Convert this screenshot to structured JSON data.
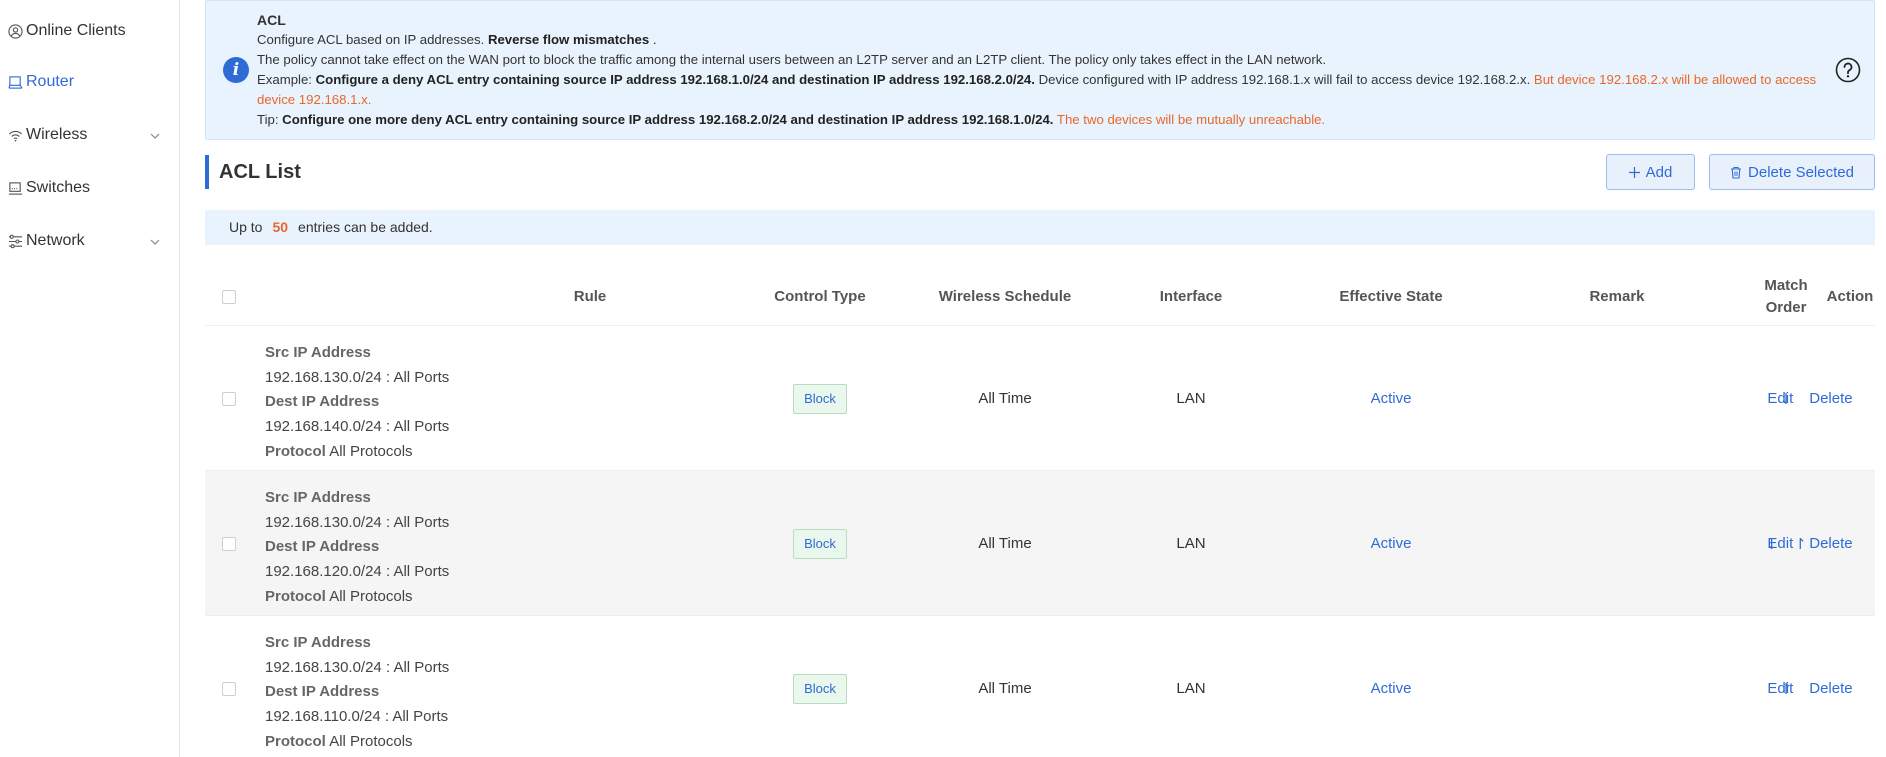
{
  "sidebar": {
    "items": [
      {
        "label": "Online Clients",
        "icon": "user-circle-icon",
        "active": false,
        "expandable": false
      },
      {
        "label": "Router",
        "icon": "router-icon",
        "active": true,
        "expandable": false
      },
      {
        "label": "Wireless",
        "icon": "wifi-icon",
        "active": false,
        "expandable": true
      },
      {
        "label": "Switches",
        "icon": "switch-icon",
        "active": false,
        "expandable": false
      },
      {
        "label": "Network",
        "icon": "network-sliders-icon",
        "active": false,
        "expandable": true
      }
    ]
  },
  "info": {
    "title": "ACL",
    "line1_pre": "Configure ACL based on IP addresses.",
    "line1_bold": "Reverse flow mismatches",
    "line1_post": ".",
    "line2": "The policy cannot take effect on the WAN port to block the traffic among the internal users between an L2TP server and an L2TP client. The policy only takes effect in the LAN network.",
    "example_label": "Example:",
    "example_bold": "Configure a deny ACL entry containing source IP address 192.168.1.0/24 and destination IP address 192.168.2.0/24.",
    "example_text": "Device configured with IP address 192.168.1.x will fail to access device 192.168.2.x.",
    "example_orange": "But device 192.168.2.x will be allowed to access device 192.168.1.x.",
    "tip_label": "Tip:",
    "tip_bold": "Configure one more deny ACL entry containing source IP address 192.168.2.0/24 and destination IP address 192.168.1.0/24.",
    "tip_orange": "The two devices will be mutually unreachable."
  },
  "section": {
    "title": "ACL List",
    "add_label": "Add",
    "delete_selected_label": "Delete Selected"
  },
  "limit": {
    "prefix": "Up to",
    "count": "50",
    "suffix": "entries can be added."
  },
  "table": {
    "headers": {
      "rule": "Rule",
      "control_type": "Control Type",
      "wireless_schedule": "Wireless Schedule",
      "interface": "Interface",
      "effective_state": "Effective State",
      "remark": "Remark",
      "match_order": "Match Order",
      "action": "Action"
    },
    "row_labels": {
      "src": "Src IP Address",
      "dest": "Dest IP Address",
      "protocol": "Protocol"
    },
    "action_labels": {
      "edit": "Edit",
      "delete": "Delete"
    },
    "rows": [
      {
        "src": "192.168.130.0/24 : All Ports",
        "dest": "192.168.140.0/24 : All Ports",
        "protocol": "All Protocols",
        "control_type": "Block",
        "schedule": "All Time",
        "interface": "LAN",
        "state": "Active",
        "remark": "",
        "order_down": "⇃",
        "order_up": ""
      },
      {
        "src": "192.168.130.0/24 : All Ports",
        "dest": "192.168.120.0/24 : All Ports",
        "protocol": "All Protocols",
        "control_type": "Block",
        "schedule": "All Time",
        "interface": "LAN",
        "state": "Active",
        "remark": "",
        "order_down": "⇃",
        "order_up": "↾"
      },
      {
        "src": "192.168.130.0/24 : All Ports",
        "dest": "192.168.110.0/24 : All Ports",
        "protocol": "All Protocols",
        "control_type": "Block",
        "schedule": "All Time",
        "interface": "LAN",
        "state": "Active",
        "remark": "",
        "order_down": "",
        "order_up": "↾"
      }
    ]
  },
  "colors": {
    "accent": "#2e6bd6",
    "warning": "#e8672a",
    "info_bg": "#e8f3fd"
  }
}
